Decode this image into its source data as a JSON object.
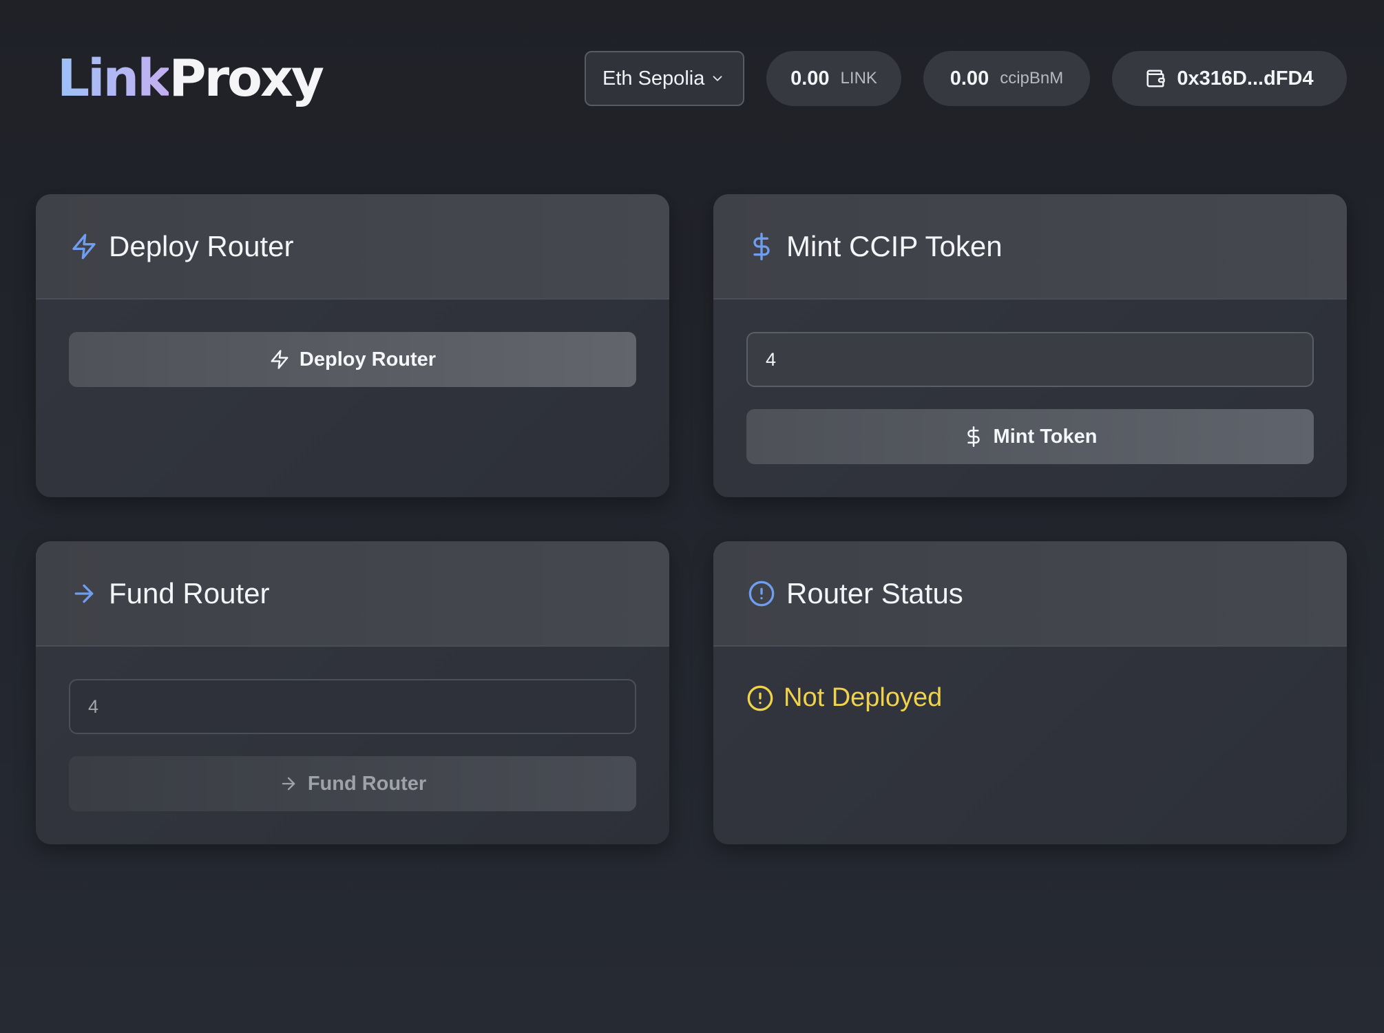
{
  "header": {
    "logo_part1": "Link",
    "logo_part2": "Proxy",
    "network": "Eth Sepolia",
    "link_balance": "0.00",
    "link_unit": "LINK",
    "bnm_balance": "0.00",
    "bnm_unit": "ccipBnM",
    "wallet_address": "0x316D...dFD4"
  },
  "cards": {
    "deploy": {
      "title": "Deploy Router",
      "button_label": "Deploy Router"
    },
    "mint": {
      "title": "Mint CCIP Token",
      "input_value": "4",
      "button_label": "Mint Token"
    },
    "fund": {
      "title": "Fund Router",
      "input_value": "4",
      "button_label": "Fund Router"
    },
    "status": {
      "title": "Router Status",
      "status_text": "Not Deployed"
    }
  },
  "colors": {
    "accent_icon": "#6f9ef0",
    "status_warning": "#f0d34a"
  },
  "icons": {
    "deploy": "lightning-icon",
    "mint": "dollar-icon",
    "fund": "arrow-right-icon",
    "status": "alert-circle-icon",
    "wallet": "wallet-icon",
    "network": "chevron-down-icon"
  }
}
